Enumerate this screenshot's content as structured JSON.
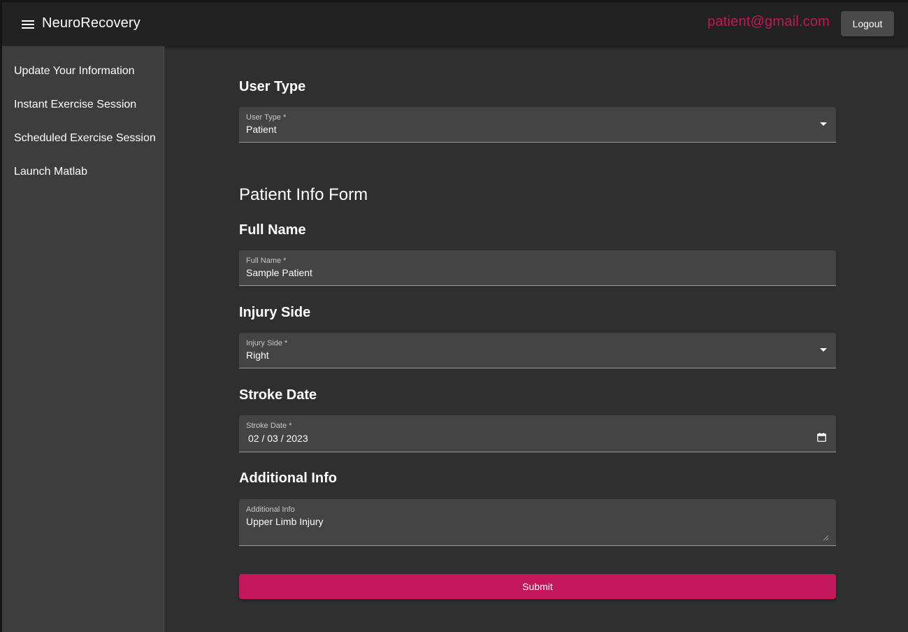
{
  "appbar": {
    "brand": "NeuroRecovery",
    "user_email": "patient@gmail.com",
    "logout_label": "Logout",
    "accent_color": "#c2185b"
  },
  "sidebar": {
    "items": [
      {
        "label": "Update Your Information"
      },
      {
        "label": "Instant Exercise Session"
      },
      {
        "label": "Scheduled Exercise Session"
      },
      {
        "label": "Launch Matlab"
      }
    ]
  },
  "main": {
    "user_type_section": {
      "heading": "User Type",
      "field_label": "User Type *",
      "value": "Patient"
    },
    "form_title": "Patient Info Form",
    "full_name": {
      "heading": "Full Name",
      "field_label": "Full Name *",
      "value": "Sample Patient"
    },
    "injury_side": {
      "heading": "Injury Side",
      "field_label": "Injury Side *",
      "value": "Right"
    },
    "stroke_date": {
      "heading": "Stroke Date",
      "field_label": "Stroke Date *",
      "value": "02 / 03 / 2023"
    },
    "additional_info": {
      "heading": "Additional Info",
      "field_label": "Additional Info",
      "value": "Upper Limb Injury"
    },
    "submit_label": "Submit"
  },
  "icons": {
    "menu": "menu-icon",
    "dropdown": "arrow-drop-down-icon",
    "calendar": "calendar-icon",
    "resize": "resize-handle-icon"
  }
}
